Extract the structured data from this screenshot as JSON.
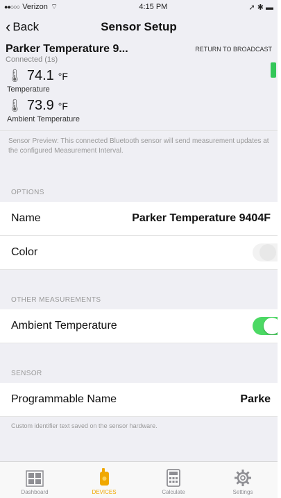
{
  "status_bar": {
    "carrier": "Verizon",
    "time": "4:15 PM"
  },
  "nav": {
    "back_label": "Back",
    "title": "Sensor Setup"
  },
  "device": {
    "name": "Parker Temperature 9...",
    "status": "Connected (1s)",
    "return_label": "RETURN TO BROADCAST"
  },
  "readings": [
    {
      "value": "74.1",
      "unit": "°F",
      "label": "Temperature"
    },
    {
      "value": "73.9",
      "unit": "°F",
      "label": "Ambient Temperature"
    }
  ],
  "preview_text": "Sensor Preview: This connected Bluetooth sensor will send measurement updates at the configured Measurement Interval.",
  "options": {
    "header": "OPTIONS",
    "name_label": "Name",
    "name_value": "Parker Temperature 9404F",
    "color_label": "Color"
  },
  "other_measurements": {
    "header": "OTHER MEASUREMENTS",
    "ambient_label": "Ambient Temperature",
    "ambient_on": true
  },
  "sensor": {
    "header": "SENSOR",
    "prog_name_label": "Programmable Name",
    "prog_name_value": "Parke",
    "footnote": "Custom identifier text saved on the sensor hardware."
  },
  "tabs": [
    {
      "label": "Dashboard",
      "icon": "grid-icon"
    },
    {
      "label": "DEVICES",
      "icon": "sensor-icon"
    },
    {
      "label": "Calculate",
      "icon": "calculator-icon"
    },
    {
      "label": "Settings",
      "icon": "gear-icon"
    }
  ],
  "colors": {
    "accent": "#f0a800",
    "toggle_on": "#4cd964",
    "indicator": "#34c759"
  }
}
